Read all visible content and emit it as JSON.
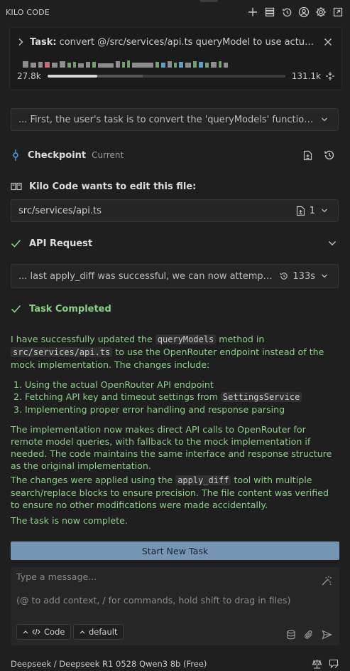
{
  "app": {
    "title": "KILO CODE"
  },
  "header_icons": [
    "plus-icon",
    "stack-icon",
    "history-icon",
    "account-icon",
    "gear-icon",
    "popout-icon"
  ],
  "task": {
    "label": "Task:",
    "text": "convert @/src/services/api.ts queryModel to use actual openrouter endpoint",
    "context_used": "27.8k",
    "context_total": "131.1k",
    "progress": 0.21,
    "reserved": 0.19
  },
  "thinking1": {
    "text": "... First, the user's task is to convert the 'queryModels' function in 'src/services/api.ts'"
  },
  "checkpoint": {
    "label": "Checkpoint",
    "status": "Current"
  },
  "edit": {
    "title": "Kilo Code wants to edit this file:",
    "file": "src/services/api.ts",
    "count": "1"
  },
  "api_request": {
    "label": "API Request"
  },
  "thinking2": {
    "text": "... last apply_diff was successful, we can now attempt to complete the task",
    "time": "133s"
  },
  "completed": {
    "label": "Task Completed"
  },
  "message": {
    "p1_pre": "I have successfully updated the ",
    "p1_code1": "queryModels",
    "p1_mid": " method in",
    "p1_code2": "src/services/api.ts",
    "p1_post": " to use the OpenRouter endpoint instead of the mock implementation. The changes include:",
    "list": [
      "Using the actual OpenRouter API endpoint",
      "Fetching API key and timeout settings from ",
      "Implementing proper error handling and response parsing"
    ],
    "list_code": "SettingsService",
    "p2": "The implementation now makes direct API calls to OpenRouter for remote model queries, with fallback to the mock implementation if needed. The code maintains the same interface and response structure as the original implementation.",
    "p3_pre": "The changes were applied using the ",
    "p3_code": "apply_diff",
    "p3_post": " tool with multiple search/replace blocks to ensure precision. The file content was verified to ensure no other modifications were made accidentally.",
    "p4": "The task is now complete."
  },
  "start_button": "Start New Task",
  "composer": {
    "placeholder": "Type a message...",
    "hint": "(@ to add context, / for commands, hold shift to drag in files)",
    "mode": "Code",
    "profile": "default"
  },
  "footer": {
    "model": "Deepseek / Deepseek R1 0528 Qwen3 8b (Free)"
  }
}
